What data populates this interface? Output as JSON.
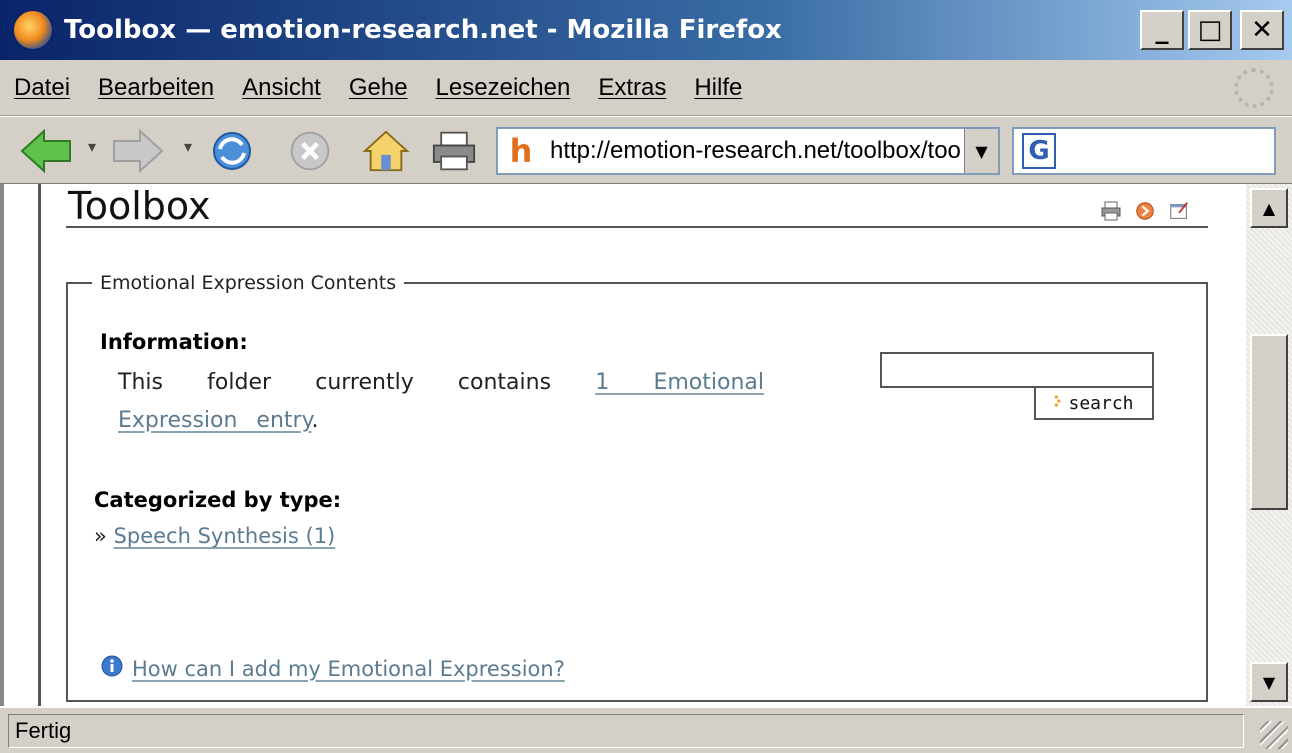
{
  "window": {
    "title": "Toolbox — emotion-research.net - Mozilla Firefox",
    "minimize_label": "_",
    "maximize_label": "□",
    "close_label": "✕"
  },
  "menu": {
    "items": [
      "Datei",
      "Bearbeiten",
      "Ansicht",
      "Gehe",
      "Lesezeichen",
      "Extras",
      "Hilfe"
    ]
  },
  "toolbar": {
    "url_favicon": "h",
    "url": "http://emotion-research.net/toolbox/toolt",
    "search_engine_icon": "G",
    "search_value": ""
  },
  "page": {
    "title": "Toolbox",
    "fieldset_legend": "Emotional Expression Contents",
    "info_heading": "Information:",
    "info_text_before": "This folder currently contains ",
    "info_link": "1 Emotional Expression entry",
    "info_text_after": ".",
    "search_button_label": "search",
    "category_heading": "Categorized by type:",
    "category_prefix": "»",
    "category_link": "Speech Synthesis (1)",
    "howto_link": "How can I add my Emotional Expression?"
  },
  "status": {
    "text": "Fertig"
  },
  "colors": {
    "title_bar": "#0a246a",
    "link": "#5b7b90",
    "chrome": "#d4d0c8"
  },
  "icons": [
    "firefox-icon",
    "back-arrow-icon",
    "forward-arrow-icon",
    "reload-icon",
    "stop-icon",
    "home-icon",
    "print-icon",
    "google-icon",
    "print-page-icon",
    "send-icon",
    "external-edit-icon",
    "info-icon",
    "search-arrow-icon"
  ]
}
